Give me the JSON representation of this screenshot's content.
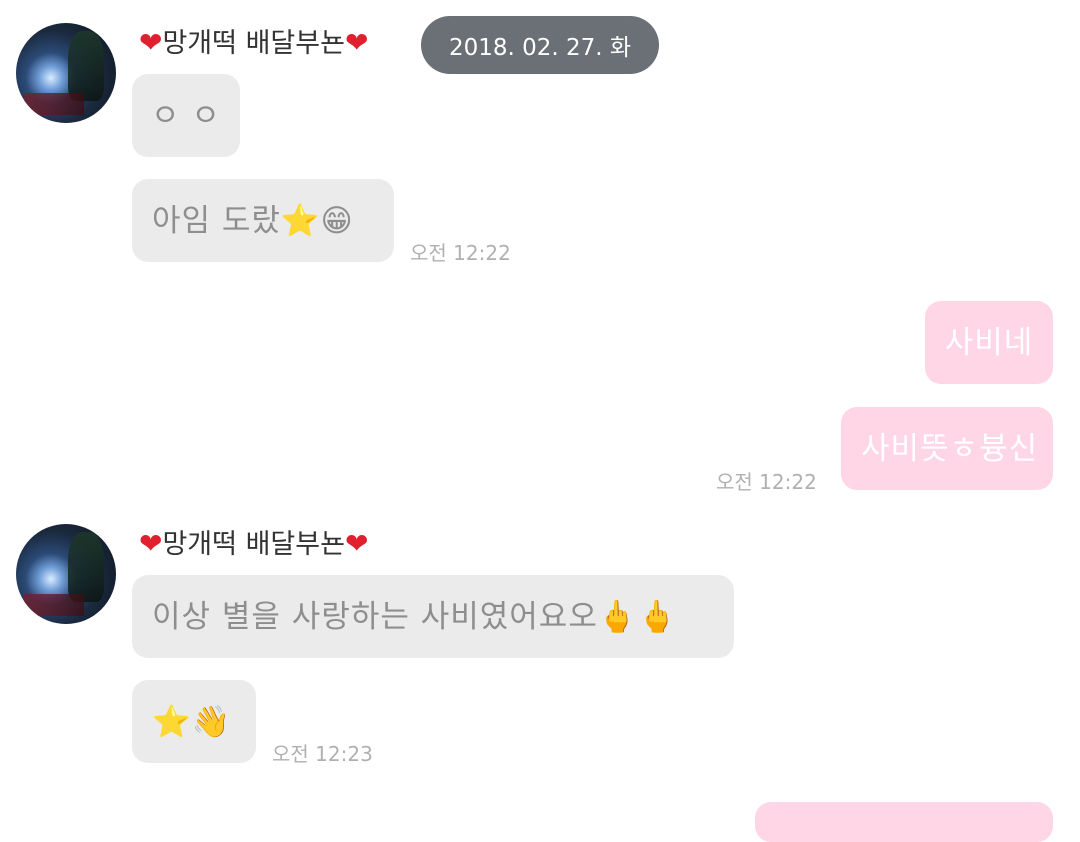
{
  "date_divider": "2018. 02. 27. 화",
  "messages": [
    {
      "sender": "망개떡 배달부뇬",
      "bubbles": [
        "ㅇ ㅇ",
        "아임 도랐⭐😁"
      ],
      "time": "오전 12:22"
    },
    {
      "outgoing": true,
      "bubbles": [
        "사비네",
        "사비뜻ㅎ븅신"
      ],
      "time": "오전 12:22"
    },
    {
      "sender": "망개떡 배달부뇬",
      "bubbles": [
        "이상 별을 사랑하는 사비였어요오🖕🖕",
        "⭐👋"
      ],
      "time": "오전 12:23"
    }
  ],
  "icons": {
    "heart": "❤",
    "heart_color": "#e0202e"
  },
  "colors": {
    "incoming_bubble": "#ebebeb",
    "outgoing_bubble": "#ffd6e6",
    "date_pill": "#6b7076"
  }
}
